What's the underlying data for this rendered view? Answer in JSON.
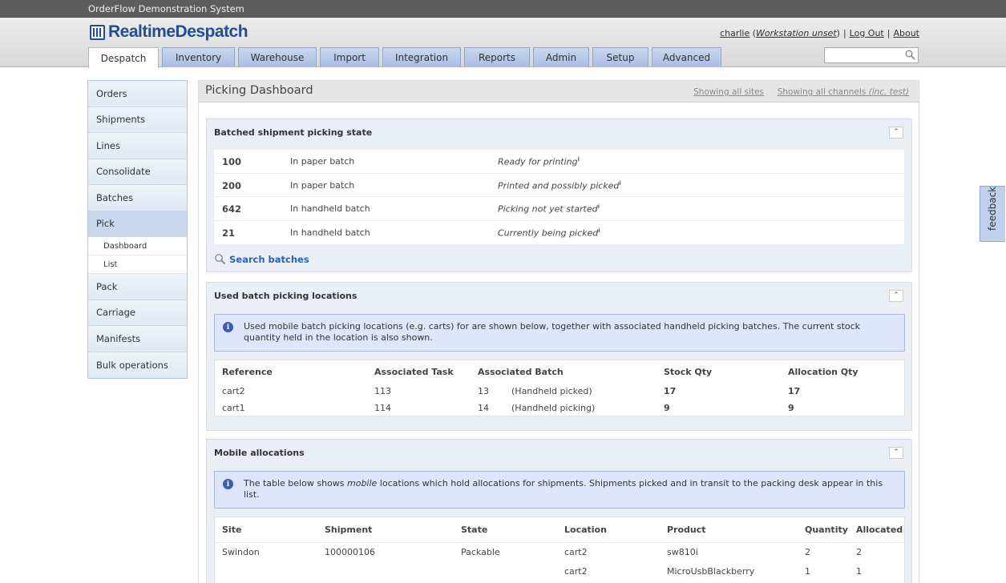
{
  "app": {
    "system_name": "OrderFlow Demonstration System",
    "logo_text": "RealtimeDespatch"
  },
  "user": {
    "name": "charlie",
    "workstation": "Workstation unset",
    "logout": "Log Out",
    "about": "About"
  },
  "tabs": [
    "Despatch",
    "Inventory",
    "Warehouse",
    "Import",
    "Integration",
    "Reports",
    "Admin",
    "Setup",
    "Advanced"
  ],
  "search": {
    "placeholder": ""
  },
  "sidebar": {
    "items": [
      "Orders",
      "Shipments",
      "Lines",
      "Consolidate",
      "Batches",
      "Pick",
      "Pack",
      "Carriage",
      "Manifests",
      "Bulk operations"
    ],
    "sub": [
      "Dashboard",
      "List"
    ]
  },
  "page": {
    "title": "Picking Dashboard",
    "filter_sites": "Showing all sites",
    "filter_channels": "Showing all channels",
    "filter_channels_note": "(inc. test)"
  },
  "batched": {
    "title": "Batched shipment picking state",
    "rows": [
      {
        "count": "100",
        "type": "In paper batch",
        "desc": "Ready for printing"
      },
      {
        "count": "200",
        "type": "In paper batch",
        "desc": "Printed and possibly picked"
      },
      {
        "count": "642",
        "type": "In handheld batch",
        "desc": "Picking not yet started"
      },
      {
        "count": "21",
        "type": "In handheld batch",
        "desc": "Currently being picked"
      }
    ],
    "info_marker": "i",
    "search_link": "Search batches"
  },
  "locations": {
    "title": "Used batch picking locations",
    "info": "Used mobile batch picking locations (e.g. carts) for are shown below, together with associated handheld picking batches. The current stock quantity held in the location is also shown.",
    "headers": [
      "Reference",
      "Associated Task",
      "Associated Batch",
      "Stock Qty",
      "Allocation Qty"
    ],
    "rows": [
      {
        "ref": "cart2",
        "task": "113",
        "batch": "13",
        "batch_state": "(Handheld picked)",
        "stock": "17",
        "alloc": "17"
      },
      {
        "ref": "cart1",
        "task": "114",
        "batch": "14",
        "batch_state": "(Handheld picking)",
        "stock": "9",
        "alloc": "9"
      }
    ]
  },
  "mobile": {
    "title": "Mobile allocations",
    "info_pre": "The table below shows ",
    "info_em": "mobile",
    "info_post": " locations which hold allocations for shipments. Shipments picked and in transit to the packing desk appear in this list.",
    "headers": [
      "Site",
      "Shipment",
      "State",
      "Location",
      "Product",
      "Quantity",
      "Allocated"
    ],
    "rows": [
      {
        "site": "Swindon",
        "shipment": "100000106",
        "state": "Packable",
        "location": "cart2",
        "product": "sw810i",
        "qty": "2",
        "alloc": "2"
      },
      {
        "site": "",
        "shipment": "",
        "state": "",
        "location": "cart2",
        "product": "MicroUsbBlackberry",
        "qty": "1",
        "alloc": "1"
      }
    ]
  },
  "feedback": "feedback"
}
